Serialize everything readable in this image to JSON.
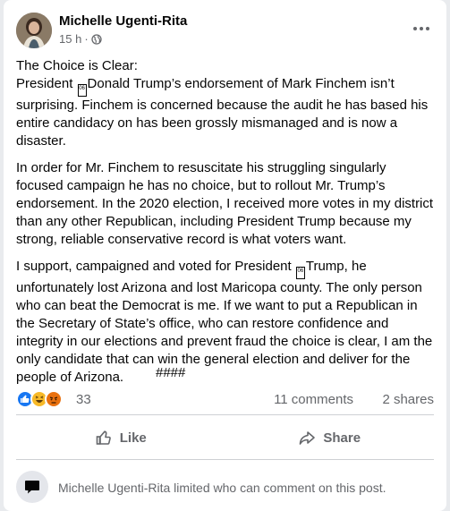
{
  "post": {
    "author": "Michelle Ugenti-Rita",
    "time": "15 h",
    "separator": "·",
    "privacy_icon": "globe-icon",
    "paragraphs": [
      {
        "line1": "The Choice is Clear:",
        "pre_glyph": "President ",
        "glyph": "06",
        "post_glyph": "Donald Trump’s endorsement of Mark Finchem isn’t surprising. Finchem is concerned because the audit he has based his entire candidacy on has been grossly mismanaged and is now a disaster."
      },
      {
        "text": "In order for Mr. Finchem to resuscitate his struggling singularly focused campaign he has no choice, but to rollout Mr. Trump’s endorsement. In the 2020 election, I received more votes in my district than any other Republican, including President Trump because my strong, reliable conservative record is what voters want."
      },
      {
        "pre_glyph": "I support, campaigned and voted for President ",
        "glyph": "06",
        "post_glyph": "Trump, he unfortunately lost Arizona and lost Maricopa county. The only person who can beat the Democrat is me. If we want to put a Republican in the Secretary of State’s office, who can restore confidence and integrity in our elections and prevent fraud the choice is clear, I am the only candidate that can win the general election and deliver for the people of Arizona."
      }
    ],
    "closing": "####"
  },
  "stats": {
    "reactions": [
      "like-reaction-icon",
      "haha-reaction-icon",
      "angry-reaction-icon"
    ],
    "reaction_count": "33",
    "comments": "11 comments",
    "shares": "2 shares"
  },
  "actions": {
    "like_label": "Like",
    "share_label": "Share"
  },
  "notice": {
    "text": "Michelle Ugenti-Rita limited who can comment on this post."
  },
  "colors": {
    "like_blue": "#1877f2",
    "secondary_text": "#65676b",
    "divider": "#ced0d4"
  }
}
